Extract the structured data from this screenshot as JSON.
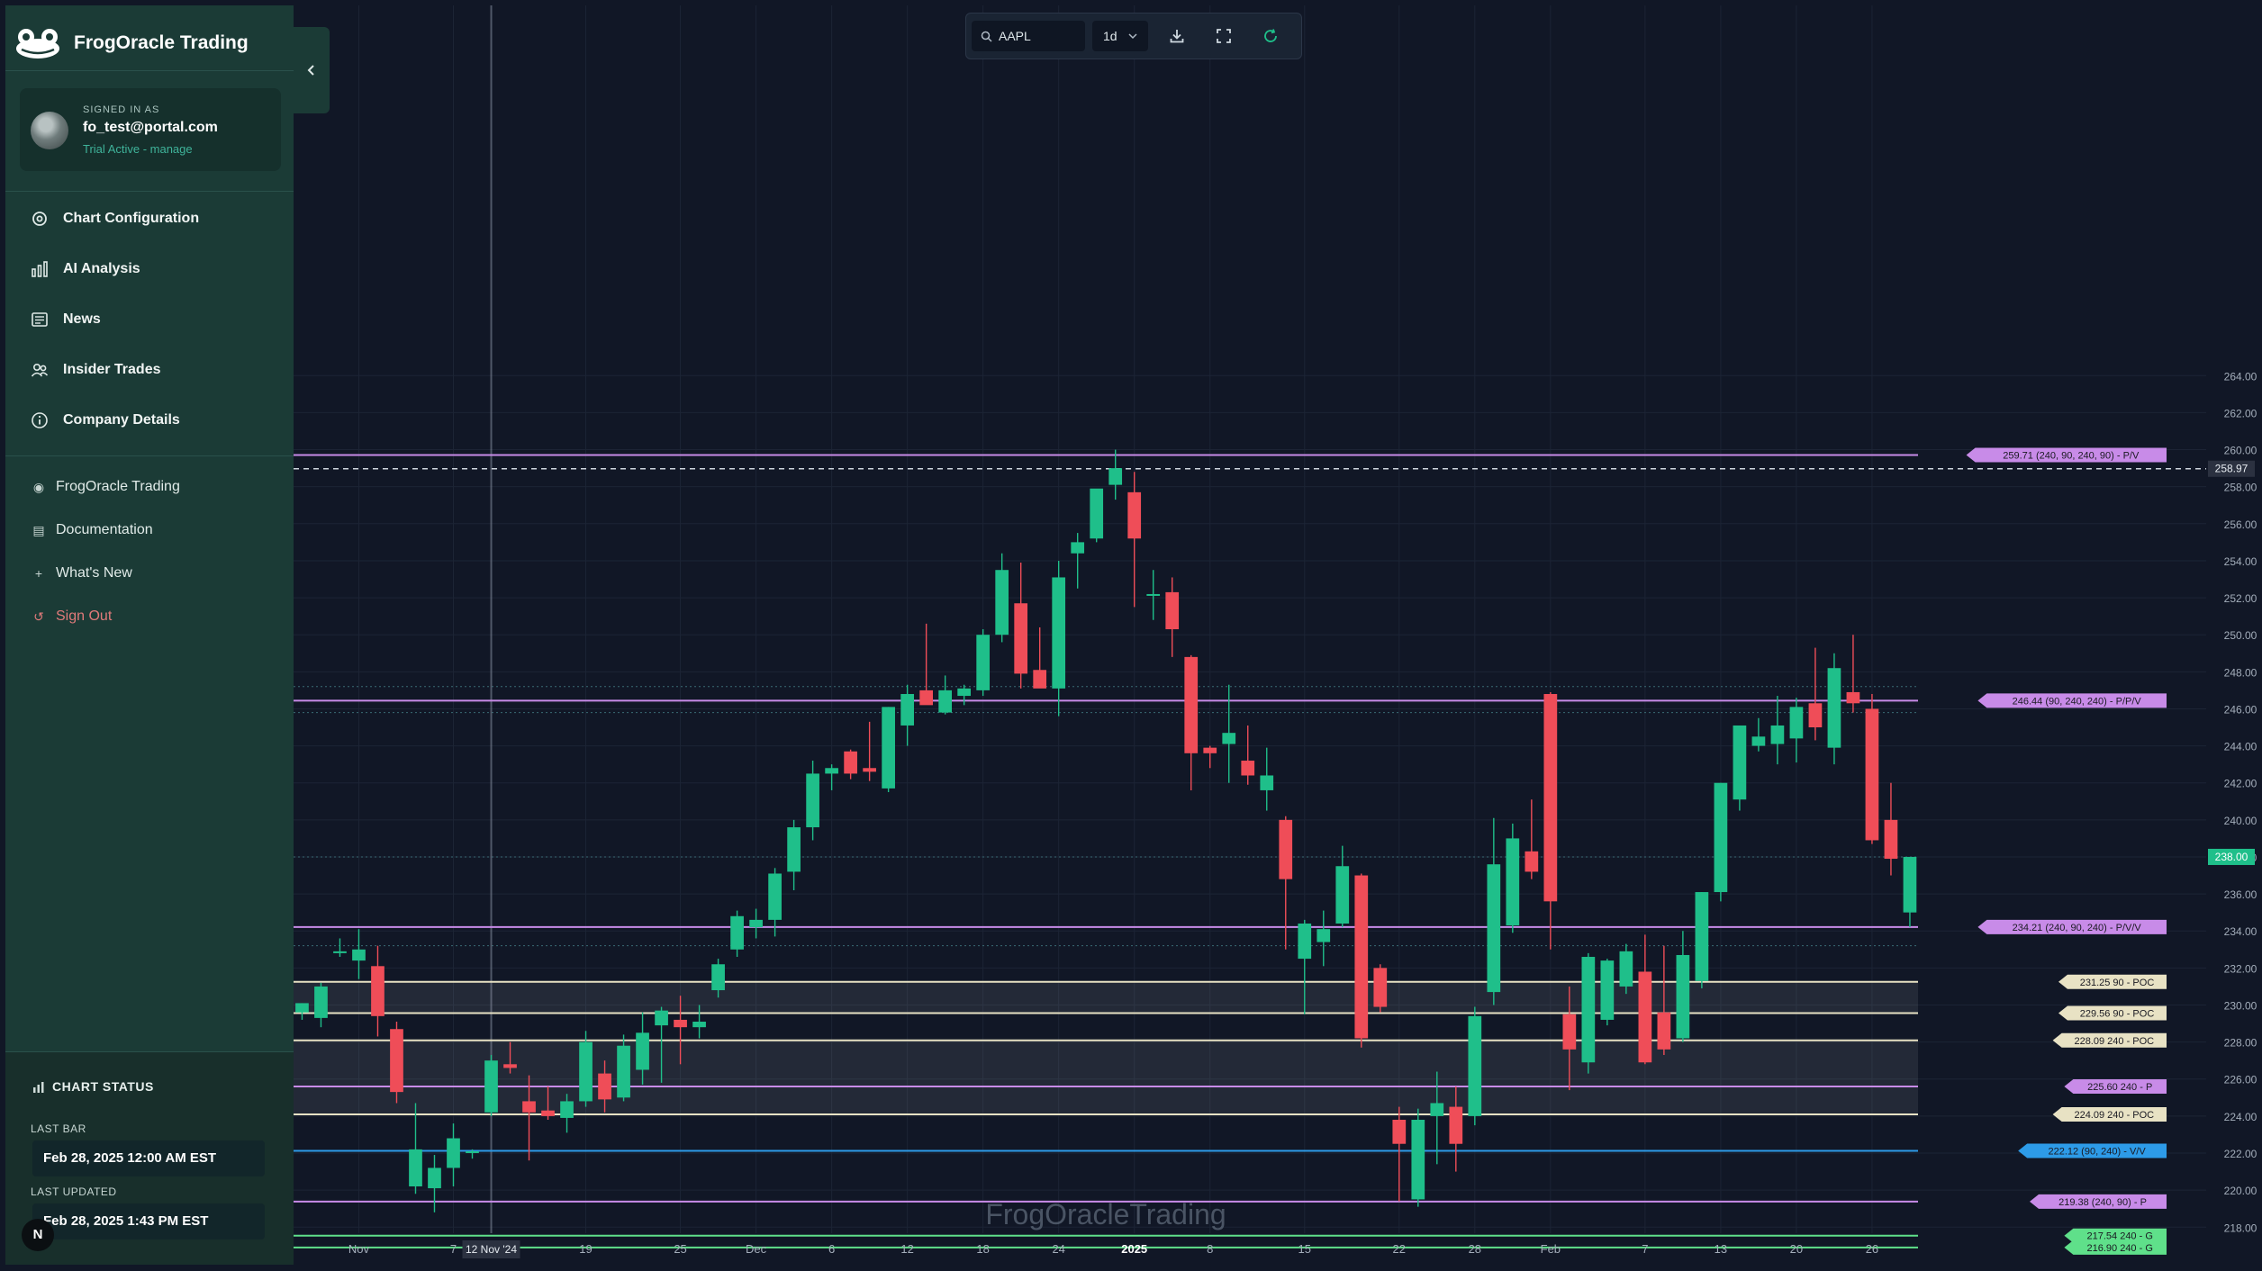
{
  "sidebar": {
    "brand": "FrogOracle Trading",
    "user": {
      "signed_in_label": "SIGNED IN AS",
      "email": "fo_test@portal.com",
      "trial": "Trial Active - manage"
    },
    "nav": [
      {
        "label": "Chart Configuration",
        "icon": "gear-icon"
      },
      {
        "label": "AI Analysis",
        "icon": "bar-chart-icon"
      },
      {
        "label": "News",
        "icon": "newspaper-icon"
      },
      {
        "label": "Insider Trades",
        "icon": "users-icon"
      },
      {
        "label": "Company Details",
        "icon": "info-icon"
      }
    ],
    "links": [
      {
        "label": "FrogOracle Trading",
        "icon": "frog-icon"
      },
      {
        "label": "Documentation",
        "icon": "document-icon"
      },
      {
        "label": "What's New",
        "icon": "plus-icon"
      },
      {
        "label": "Sign Out",
        "icon": "logout-icon"
      }
    ],
    "status": {
      "title": "CHART STATUS",
      "last_bar_label": "LAST BAR",
      "last_bar": "Feb 28, 2025 12:00 AM EST",
      "last_updated_label": "LAST UPDATED",
      "last_updated": "Feb 28, 2025 1:43 PM EST"
    },
    "badge": "N"
  },
  "toolbar": {
    "symbol": "AAPL",
    "interval": "1d",
    "buttons": [
      "download-icon",
      "fullscreen-icon",
      "refresh-icon"
    ]
  },
  "chart_data": {
    "type": "candlestick",
    "symbol": "AAPL",
    "watermark": "FrogOracleTrading",
    "y_range": [
      216.7,
      284.0
    ],
    "y_ticks": [
      218,
      220,
      222,
      224,
      226,
      228,
      230,
      232,
      234,
      236,
      238,
      240,
      242,
      244,
      246,
      248,
      250,
      252,
      254,
      256,
      258,
      260,
      262,
      264
    ],
    "x_ticks": [
      "Nov",
      "7",
      "19",
      "25",
      "Dec",
      "6",
      "12",
      "18",
      "24",
      "2025",
      "8",
      "15",
      "22",
      "28",
      "Feb",
      "7",
      "13",
      "20",
      "26"
    ],
    "crosshair_label": "12 Nov '24",
    "current_price": "238.00",
    "dashed_price": "258.97",
    "candles": [
      {
        "o": 229.6,
        "h": 230.1,
        "l": 229.2,
        "c": 230.1
      },
      {
        "o": 229.3,
        "h": 231.2,
        "l": 228.8,
        "c": 231.0
      },
      {
        "o": 232.8,
        "h": 233.6,
        "l": 232.6,
        "c": 232.9
      },
      {
        "o": 232.4,
        "h": 234.1,
        "l": 231.4,
        "c": 233.0
      },
      {
        "o": 232.1,
        "h": 233.2,
        "l": 228.3,
        "c": 229.4
      },
      {
        "o": 228.7,
        "h": 229.1,
        "l": 224.7,
        "c": 225.3
      },
      {
        "o": 220.2,
        "h": 224.7,
        "l": 219.8,
        "c": 222.2
      },
      {
        "o": 220.1,
        "h": 221.9,
        "l": 218.8,
        "c": 221.2
      },
      {
        "o": 221.2,
        "h": 223.6,
        "l": 220.2,
        "c": 222.8
      },
      {
        "o": 222.0,
        "h": 222.2,
        "l": 221.7,
        "c": 222.1
      },
      {
        "o": 224.2,
        "h": 227.3,
        "l": 224.0,
        "c": 227.0
      },
      {
        "o": 226.8,
        "h": 228.0,
        "l": 226.3,
        "c": 226.6
      },
      {
        "o": 224.8,
        "h": 226.2,
        "l": 221.6,
        "c": 224.2
      },
      {
        "o": 224.3,
        "h": 225.6,
        "l": 223.8,
        "c": 224.0
      },
      {
        "o": 223.9,
        "h": 225.2,
        "l": 223.1,
        "c": 224.8
      },
      {
        "o": 224.8,
        "h": 228.6,
        "l": 224.5,
        "c": 228.0
      },
      {
        "o": 226.3,
        "h": 227.0,
        "l": 224.2,
        "c": 224.9
      },
      {
        "o": 225.0,
        "h": 228.4,
        "l": 224.8,
        "c": 227.8
      },
      {
        "o": 226.5,
        "h": 229.6,
        "l": 225.7,
        "c": 228.5
      },
      {
        "o": 228.9,
        "h": 229.9,
        "l": 225.8,
        "c": 229.7
      },
      {
        "o": 229.2,
        "h": 230.5,
        "l": 226.8,
        "c": 228.8
      },
      {
        "o": 228.8,
        "h": 230.0,
        "l": 228.2,
        "c": 229.1
      },
      {
        "o": 230.8,
        "h": 232.5,
        "l": 230.4,
        "c": 232.2
      },
      {
        "o": 233.0,
        "h": 235.1,
        "l": 232.6,
        "c": 234.8
      },
      {
        "o": 234.2,
        "h": 235.2,
        "l": 233.6,
        "c": 234.6
      },
      {
        "o": 234.6,
        "h": 237.4,
        "l": 233.7,
        "c": 237.1
      },
      {
        "o": 237.2,
        "h": 240.0,
        "l": 236.2,
        "c": 239.6
      },
      {
        "o": 239.6,
        "h": 243.2,
        "l": 238.9,
        "c": 242.5
      },
      {
        "o": 242.5,
        "h": 243.0,
        "l": 241.6,
        "c": 242.8
      },
      {
        "o": 243.7,
        "h": 243.8,
        "l": 242.2,
        "c": 242.5
      },
      {
        "o": 242.8,
        "h": 245.3,
        "l": 242.1,
        "c": 242.6
      },
      {
        "o": 241.7,
        "h": 246.1,
        "l": 241.5,
        "c": 246.1
      },
      {
        "o": 245.1,
        "h": 247.3,
        "l": 244.0,
        "c": 246.8
      },
      {
        "o": 247.0,
        "h": 250.6,
        "l": 246.5,
        "c": 246.2
      },
      {
        "o": 245.8,
        "h": 247.8,
        "l": 245.7,
        "c": 247.0
      },
      {
        "o": 246.7,
        "h": 247.3,
        "l": 246.2,
        "c": 247.1
      },
      {
        "o": 247.0,
        "h": 250.3,
        "l": 246.7,
        "c": 250.0
      },
      {
        "o": 250.0,
        "h": 254.4,
        "l": 249.6,
        "c": 253.5
      },
      {
        "o": 251.7,
        "h": 253.9,
        "l": 247.1,
        "c": 247.9
      },
      {
        "o": 248.1,
        "h": 250.4,
        "l": 247.2,
        "c": 247.1
      },
      {
        "o": 247.1,
        "h": 254.0,
        "l": 245.6,
        "c": 253.1
      },
      {
        "o": 254.4,
        "h": 255.5,
        "l": 252.5,
        "c": 255.0
      },
      {
        "o": 255.2,
        "h": 257.3,
        "l": 255.0,
        "c": 257.9
      },
      {
        "o": 258.1,
        "h": 260.0,
        "l": 257.3,
        "c": 259.0
      },
      {
        "o": 257.7,
        "h": 258.8,
        "l": 251.5,
        "c": 255.2
      },
      {
        "o": 252.2,
        "h": 253.5,
        "l": 250.8,
        "c": 252.2
      },
      {
        "o": 252.3,
        "h": 253.1,
        "l": 248.8,
        "c": 250.3
      },
      {
        "o": 248.8,
        "h": 248.9,
        "l": 241.6,
        "c": 243.6
      },
      {
        "o": 243.9,
        "h": 244.0,
        "l": 242.8,
        "c": 243.6
      },
      {
        "o": 244.1,
        "h": 247.3,
        "l": 242.0,
        "c": 244.7
      },
      {
        "o": 243.2,
        "h": 245.1,
        "l": 241.9,
        "c": 242.4
      },
      {
        "o": 241.6,
        "h": 243.9,
        "l": 240.5,
        "c": 242.4
      },
      {
        "o": 240.0,
        "h": 240.2,
        "l": 233.0,
        "c": 236.8
      },
      {
        "o": 232.5,
        "h": 234.6,
        "l": 229.5,
        "c": 234.4
      },
      {
        "o": 233.4,
        "h": 235.1,
        "l": 232.1,
        "c": 234.1
      },
      {
        "o": 234.4,
        "h": 238.6,
        "l": 234.2,
        "c": 237.5
      },
      {
        "o": 237.0,
        "h": 237.1,
        "l": 227.7,
        "c": 228.2
      },
      {
        "o": 232.0,
        "h": 232.2,
        "l": 229.6,
        "c": 229.9
      },
      {
        "o": 223.8,
        "h": 224.5,
        "l": 219.4,
        "c": 222.5
      },
      {
        "o": 219.5,
        "h": 224.4,
        "l": 219.1,
        "c": 223.8
      },
      {
        "o": 224.0,
        "h": 226.4,
        "l": 221.4,
        "c": 224.7
      },
      {
        "o": 224.5,
        "h": 225.6,
        "l": 221.0,
        "c": 222.5
      },
      {
        "o": 224.0,
        "h": 229.9,
        "l": 223.5,
        "c": 229.4
      },
      {
        "o": 230.7,
        "h": 240.1,
        "l": 230.0,
        "c": 237.6
      },
      {
        "o": 234.3,
        "h": 239.8,
        "l": 233.9,
        "c": 239.0
      },
      {
        "o": 238.3,
        "h": 241.1,
        "l": 236.8,
        "c": 237.2
      },
      {
        "o": 246.8,
        "h": 246.9,
        "l": 233.0,
        "c": 235.6
      },
      {
        "o": 229.5,
        "h": 231.0,
        "l": 225.4,
        "c": 227.6
      },
      {
        "o": 226.9,
        "h": 232.8,
        "l": 226.3,
        "c": 232.6
      },
      {
        "o": 229.2,
        "h": 232.5,
        "l": 228.9,
        "c": 232.4
      },
      {
        "o": 231.0,
        "h": 233.3,
        "l": 230.6,
        "c": 232.9
      },
      {
        "o": 231.8,
        "h": 233.8,
        "l": 226.8,
        "c": 226.9
      },
      {
        "o": 229.6,
        "h": 233.2,
        "l": 227.3,
        "c": 227.6
      },
      {
        "o": 228.2,
        "h": 234.0,
        "l": 228.0,
        "c": 232.7
      },
      {
        "o": 231.3,
        "h": 236.1,
        "l": 230.9,
        "c": 236.1
      },
      {
        "o": 236.1,
        "h": 242.0,
        "l": 235.6,
        "c": 242.0
      },
      {
        "o": 241.1,
        "h": 245.0,
        "l": 240.5,
        "c": 245.1
      },
      {
        "o": 244.0,
        "h": 245.5,
        "l": 243.7,
        "c": 244.5
      },
      {
        "o": 244.1,
        "h": 246.7,
        "l": 243.0,
        "c": 245.1
      },
      {
        "o": 244.4,
        "h": 246.6,
        "l": 243.1,
        "c": 246.1
      },
      {
        "o": 246.3,
        "h": 249.3,
        "l": 244.3,
        "c": 245.0
      },
      {
        "o": 243.9,
        "h": 249.0,
        "l": 243.0,
        "c": 248.2
      },
      {
        "o": 246.9,
        "h": 250.0,
        "l": 245.8,
        "c": 246.3
      },
      {
        "o": 246.0,
        "h": 246.8,
        "l": 238.7,
        "c": 238.9
      },
      {
        "o": 240.0,
        "h": 242.0,
        "l": 237.0,
        "c": 237.9
      },
      {
        "o": 235.0,
        "h": 238.0,
        "l": 234.2,
        "c": 238.0
      }
    ],
    "levels": [
      {
        "price": 259.71,
        "label": "259.71 (240, 90, 240, 90) - P/V",
        "color": "#c88be8"
      },
      {
        "price": 246.44,
        "label": "246.44 (90, 240, 240) - P/P/V",
        "color": "#c88be8"
      },
      {
        "price": 234.21,
        "label": "234.21 (240, 90, 240) - P/V/V",
        "color": "#c88be8"
      },
      {
        "price": 231.25,
        "label": "231.25 90 - POC",
        "color": "#e8e2c4"
      },
      {
        "price": 229.56,
        "label": "229.56 90 - POC",
        "color": "#e8e2c4"
      },
      {
        "price": 228.09,
        "label": "228.09 240 - POC",
        "color": "#e8e2c4"
      },
      {
        "price": 225.6,
        "label": "225.60 240 - P",
        "color": "#c88be8"
      },
      {
        "price": 224.09,
        "label": "224.09 240 - POC",
        "color": "#e8e2c4"
      },
      {
        "price": 222.12,
        "label": "222.12 (90, 240) - V/V",
        "color": "#2d9be8"
      },
      {
        "price": 219.38,
        "label": "219.38 (240, 90) - P",
        "color": "#c88be8"
      },
      {
        "price": 217.54,
        "label": "217.54 240 - G",
        "color": "#5fe08a"
      },
      {
        "price": 216.9,
        "label": "216.90 240 - G",
        "color": "#5fe08a"
      }
    ],
    "colors": {
      "up": "#1fbf8a",
      "down": "#ef4d58",
      "background": "#111726",
      "grid": "#1c2435"
    }
  }
}
